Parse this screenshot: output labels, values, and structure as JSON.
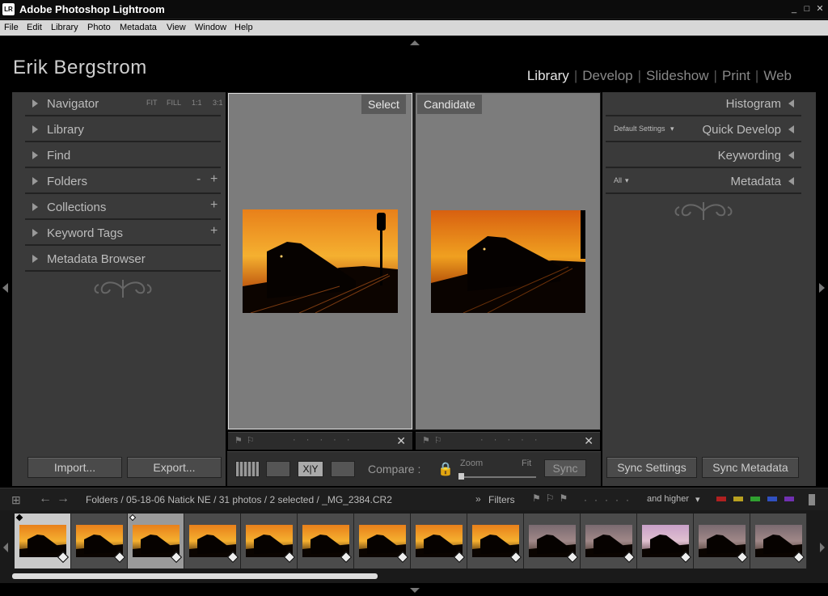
{
  "window": {
    "app_icon": "LR",
    "title": "Adobe Photoshop Lightroom",
    "controls": [
      "_",
      "□",
      "✕"
    ]
  },
  "menu": [
    "File",
    "Edit",
    "Library",
    "Photo",
    "Metadata",
    "View",
    "Window",
    "Help"
  ],
  "identity_plate": "Erik Bergstrom",
  "modules": [
    "Library",
    "Develop",
    "Slideshow",
    "Print",
    "Web"
  ],
  "module_separator": "|",
  "left_panel": {
    "navigator": {
      "label": "Navigator",
      "zoom_options": [
        "FIT",
        "FILL",
        "1:1",
        "3:1"
      ]
    },
    "sections": [
      "Library",
      "Find",
      "Folders",
      "Collections",
      "Keyword Tags",
      "Metadata Browser"
    ],
    "folders_controls": [
      "-",
      "+"
    ],
    "plus": "+",
    "import_label": "Import...",
    "export_label": "Export..."
  },
  "right_panel": {
    "histogram": "Histogram",
    "quick_develop": "Quick Develop",
    "preset": "Default Settings",
    "keywording": "Keywording",
    "metadata": "Metadata",
    "metadata_preset": "All",
    "sync_settings_label": "Sync Settings",
    "sync_metadata_label": "Sync Metadata"
  },
  "compare": {
    "select_label": "Select",
    "candidate_label": "Candidate",
    "close": "✕",
    "compare_label": "Compare :",
    "zoom_label": "Zoom",
    "fit_label": "Fit",
    "sync_label": "Sync",
    "xy_label": "X|Y"
  },
  "filmstrip": {
    "path": "Folders / 05-18-06 Natick NE / 31 photos / 2 selected / _MG_2384.CR2",
    "filters_label": "Filters",
    "rating_filter": "and higher",
    "label_colors": [
      "#b02020",
      "#b8a020",
      "#30a030",
      "#3050c0",
      "#7030b0"
    ],
    "thumbnails": [
      {
        "tone": "sunset",
        "state": "selected"
      },
      {
        "tone": "sunset",
        "state": "normal"
      },
      {
        "tone": "sunset",
        "state": "candidate"
      },
      {
        "tone": "sunset",
        "state": "normal"
      },
      {
        "tone": "sunset",
        "state": "normal"
      },
      {
        "tone": "sunset",
        "state": "normal"
      },
      {
        "tone": "sunset",
        "state": "normal"
      },
      {
        "tone": "sunset",
        "state": "normal"
      },
      {
        "tone": "sunset",
        "state": "normal"
      },
      {
        "tone": "engine",
        "state": "normal"
      },
      {
        "tone": "engine",
        "state": "normal"
      },
      {
        "tone": "engine-pink",
        "state": "normal"
      },
      {
        "tone": "engine",
        "state": "normal"
      },
      {
        "tone": "engine",
        "state": "normal"
      }
    ]
  }
}
